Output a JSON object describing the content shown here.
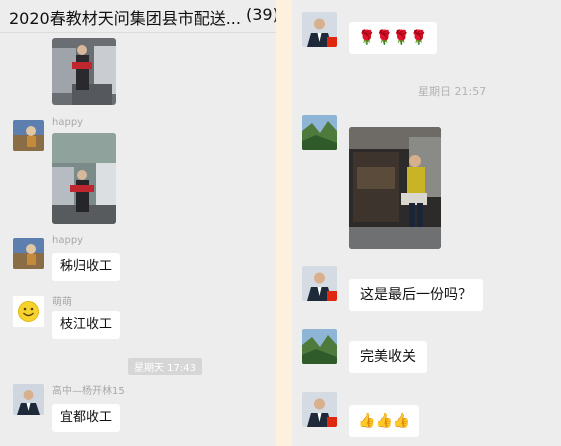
{
  "left_chat": {
    "title": "2020春教材天问集团县市配送...",
    "member_count": "(39)",
    "messages": [
      {
        "sender": "happy"
      },
      {
        "sender": "happy",
        "text": "秭归收工"
      },
      {
        "sender": "萌萌",
        "text": "枝江收工"
      },
      {
        "sender": "高中—杨开林15",
        "text": "宜都收工"
      }
    ],
    "timestamp": "星期天 17:43"
  },
  "right_chat": {
    "timestamp": "星期日 21:57",
    "messages": [
      {
        "text": "这是最后一份吗？"
      },
      {
        "text": "完美收关"
      }
    ]
  },
  "colors": {
    "page_bg": "#fdf0dc",
    "chat_bg": "#ededed",
    "bubble": "#ffffff",
    "muted": "#a8a8a8"
  },
  "icons": [
    "rose-emoji",
    "thumbs-up-emoji",
    "smiley-avatar",
    "mountain-avatar",
    "suit-avatar"
  ]
}
